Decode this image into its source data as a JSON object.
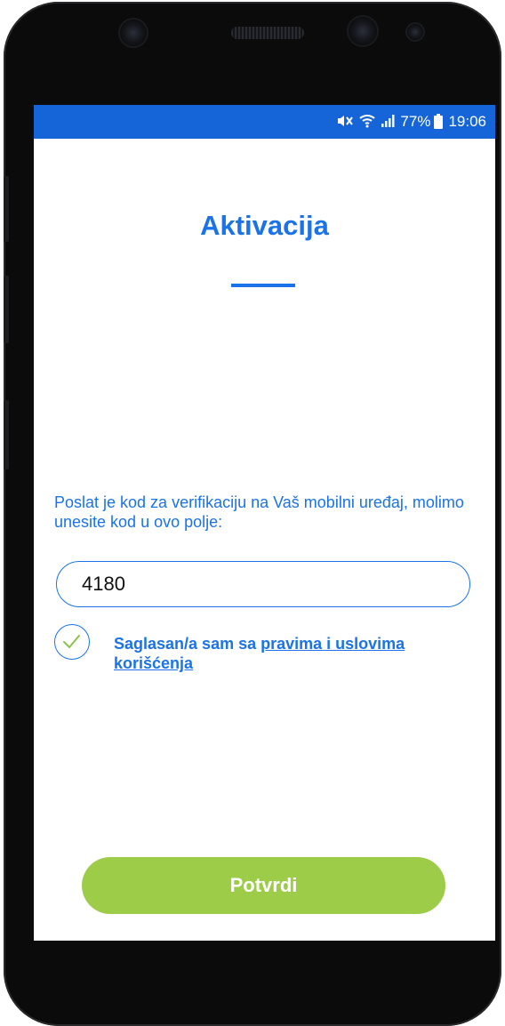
{
  "status_bar": {
    "signal_icons": [
      "mute-icon",
      "wifi-icon",
      "cellular-signal-icon",
      "battery-charging-icon"
    ],
    "battery": "77%",
    "time": "19:06"
  },
  "screen": {
    "title": "Aktivacija",
    "instruction": "Poslat je kod za verifikaciju na Vaš mobilni uređaj, molimo unesite kod u ovo polje:",
    "code_value": "4180",
    "agree_prefix": "Saglasan/a sam sa ",
    "agree_link": "pravima i uslovima korišćenja",
    "agree_checked": true,
    "confirm_label": "Potvrdi"
  },
  "colors": {
    "accent": "#1a73e8",
    "status_bar": "#1565d8",
    "confirm_button": "#9ccc48",
    "check_mark": "#8bc34a"
  }
}
